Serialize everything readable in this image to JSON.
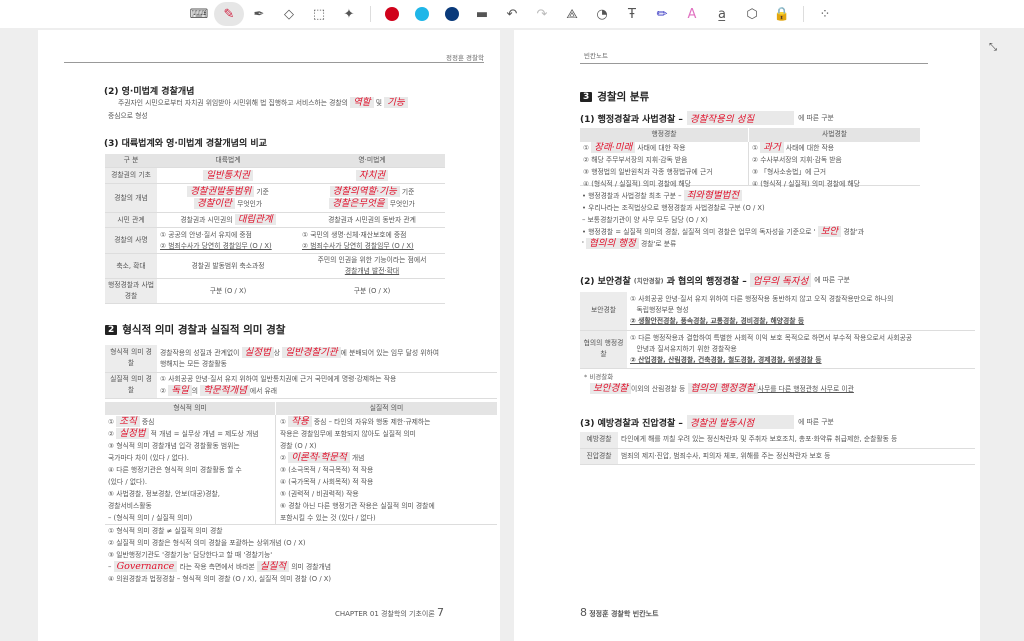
{
  "toolbar": {
    "colors": [
      "#d0021b",
      "#1fb6e8",
      "#0a3a7a"
    ],
    "icons": [
      "keyboard-icon",
      "pen-icon",
      "highlighter-icon",
      "eraser-icon",
      "lasso-select-icon",
      "ai-sparkle-icon",
      "line-thickness-icon",
      "undo-icon",
      "redo-icon",
      "shape-recognize-icon",
      "timer-pen-icon",
      "text-pen-icon",
      "blue-marker-icon",
      "text-style-icon",
      "text-convert-icon",
      "shapes-icon",
      "lock-icon",
      "more-grid-icon"
    ]
  },
  "left": {
    "header": "정정훈 경찰학",
    "s2_title": "(2) 영·미법계 경찰개념",
    "s2_text1": "주권자인 시민으로부터 자치권 위임받아 시민위해 법 집행하고 서비스하는 경찰의",
    "s2_hw1": "역할",
    "s2_and": "및",
    "s2_hw2": "기능",
    "s2_text2": "중심으로 형성",
    "s3_title": "(3) 대륙법계와 영·미법계 경찰개념의 비교",
    "t1_head": [
      "구 분",
      "대륙법계",
      "영·미법계"
    ],
    "t1": {
      "r1": {
        "k": "경찰권의 기초",
        "a": "일반통치권",
        "b": "자치권"
      },
      "r2": {
        "k": "경찰의 개념",
        "a1": "경찰권발동범위",
        "a1s": "기준",
        "a2": "경찰이란",
        "a2s": "무엇인가",
        "b1": "경찰의역할·기능",
        "b1s": "기준",
        "b2": "경찰은무엇을",
        "b2s": "무엇인가"
      },
      "r3": {
        "k": "시민 관계",
        "a_pre": "경찰권과 시민권의",
        "a": "대립관계",
        "b": "경찰권과 시민권의 동반자 관계"
      },
      "r4": {
        "k": "경찰의 사명",
        "a1": "① 공공의 안녕·질서 유지에 중점",
        "a2": "② 범죄수사가 당연히 경찰임무 (O / X)",
        "b1": "① 국민의 생명·신체·재산보호에 중점",
        "b2": "② 범죄수사가 당연히 경찰임무 (O / X)"
      },
      "r5": {
        "k": "축소, 확대",
        "a": "경찰권 발동범위 축소과정",
        "b1": "주민의 인권을 위한 기능이라는 점에서",
        "b2": "경찰개념 발전·확대"
      },
      "r6": {
        "k": "행정경찰과 사법경찰",
        "a": "구분 (O / X)",
        "b": "구분 (O / X)"
      }
    },
    "sec2_num": "2",
    "sec2_title": "형식적 의미 경찰과 실질적 의미 경찰",
    "t2": {
      "r1k": "형식적 의미 경찰",
      "r1_pre": "경찰작용의 성질과 관계없이",
      "r1_hw1": "실정법",
      "r1_mid": "상",
      "r1_hw2": "일반경찰기관",
      "r1_post": "에 분배되어 있는 임무 달성 위하여",
      "r1_2": "행해지는 모든 경찰활동",
      "r2k": "실질적 의미 경찰",
      "r2_1": "① 사회공공 안녕·질서 유지 위하여 일반통치권에 근거 국민에게 명령·강제하는 작용",
      "r2_pre": "②",
      "r2_hw1": "독일",
      "r2_mid": "의",
      "r2_hw2": "학문적개념",
      "r2_post": "에서 유래"
    },
    "t3_head": [
      "형식적 의미",
      "실질적 의미"
    ],
    "t3_left": [
      {
        "pre": "①",
        "hw": "조직",
        "post": "중심"
      },
      {
        "pre": "②",
        "hw": "실정법",
        "post": "적 개념 = 실무상 개념 = 제도상 개념"
      },
      {
        "pre": "③ 형식적 의미 경찰개념 입각 경찰활동 범위는",
        "hw": "",
        "post": ""
      },
      {
        "pre": "국가마다 차이 (있다 / 없다).",
        "hw": "",
        "post": ""
      },
      {
        "pre": "④ 다른 행정기관은 형식적 의미 경찰활동 할 수",
        "hw": "",
        "post": ""
      },
      {
        "pre": "(있다 / 없다).",
        "hw": "",
        "post": ""
      },
      {
        "pre": "⑤ 사법경찰, 정보경찰, 안보(대공)경찰,",
        "hw": "",
        "post": ""
      },
      {
        "pre": "경찰서비스활동",
        "hw": "",
        "post": ""
      },
      {
        "pre": "– (형식적 의미 / 실질적 의미)",
        "hw": "",
        "post": ""
      }
    ],
    "t3_right": [
      {
        "pre": "①",
        "hw": "작용",
        "post": "중심 – 타인의 자유와 행동 제한·규제하는"
      },
      {
        "pre": "작용은 경찰임무에 포함되지 않아도 실질적 의미",
        "hw": "",
        "post": ""
      },
      {
        "pre": "경찰 (O / X)",
        "hw": "",
        "post": ""
      },
      {
        "pre": "②",
        "hw": "이론적·학문적",
        "post": "개념"
      },
      {
        "pre": "③ (소극목적 / 적극목적) 적 작용",
        "hw": "",
        "post": ""
      },
      {
        "pre": "④ (국가목적 / 사회목적) 적 작용",
        "hw": "",
        "post": ""
      },
      {
        "pre": "⑤ (권력적 / 비권력적) 작용",
        "hw": "",
        "post": ""
      },
      {
        "pre": "⑥ 경찰 아닌 다른 행정기관 작용은 실질적 의미 경찰에",
        "hw": "",
        "post": ""
      },
      {
        "pre": "포함시킬 수 있는 것 (있다 / 없다)",
        "hw": "",
        "post": ""
      }
    ],
    "notes": [
      {
        "pre": "① 형식적 의미 경찰 ≠ 실질적 의미 경찰",
        "hw": "",
        "post": ""
      },
      {
        "pre": "② 실질적 의미 경찰은 형식적 의미 경찰을 포괄하는 상위개념 (O / X)",
        "hw": "",
        "post": ""
      },
      {
        "pre": "③ 일반행정기관도 '경찰기능' 담당한다고 할 때 '경찰기능'",
        "hw": "",
        "post": ""
      },
      {
        "pre": "–",
        "hw": "Governance",
        "post": "라는 작용 측면에서 바라본",
        "hw2": "실질적",
        "post2": "의미 경찰개념"
      },
      {
        "pre": "④ 의원경찰과 법정경찰 – 형식적 의미 경찰 (O / X), 실질적 의미 경찰 (O / X)",
        "hw": "",
        "post": ""
      }
    ],
    "footer_chapter": "CHAPTER 01  경찰학의 기초이론",
    "footer_page": "7"
  },
  "right": {
    "header": "빈칸노트",
    "sec3_num": "3",
    "sec3_title": "경찰의 분류",
    "p1_title": "(1) 행정경찰과 사법경찰 –",
    "p1_hw": "경찰작용의 성질",
    "p1_post": "에 따른 구분",
    "t4_head": [
      "행정경찰",
      "사법경찰"
    ],
    "t4_left": [
      {
        "pre": "①",
        "hw": "장래·미래",
        "post": "사태에 대한 작용"
      },
      {
        "pre": "② 해당 주무부서장의 지휘·감독 받음",
        "hw": "",
        "post": ""
      },
      {
        "pre": "③ 행정법의 일반원칙과 각종 행정법규에 근거",
        "hw": "",
        "post": ""
      },
      {
        "pre": "④ (형식적 / 실질적) 의미 경찰에 해당",
        "hw": "",
        "post": ""
      }
    ],
    "t4_right": [
      {
        "pre": "①",
        "hw": "과거",
        "post": "사태에 대한 작용"
      },
      {
        "pre": "② 수사부서장의 지휘·감독 받음",
        "hw": "",
        "post": ""
      },
      {
        "pre": "③ 「형사소송법」에 근거",
        "hw": "",
        "post": ""
      },
      {
        "pre": "④ (형식적 / 실질적) 의미 경찰에 해당",
        "hw": "",
        "post": ""
      }
    ],
    "bullets": [
      {
        "pre": "• 행정경찰과 사법경찰 최초 구분 –",
        "hw": "죄와형벌법전",
        "post": ""
      },
      {
        "pre": "• 우리나라는 조직법상으로 행정경찰과 사법경찰로 구분 (O / X)",
        "hw": "",
        "post": ""
      },
      {
        "pre": "  – 보통경찰기관이 양 사무 모두 담당 (O / X)",
        "hw": "",
        "post": ""
      },
      {
        "pre": "• 행정경찰 = 실질적 의미의 경찰, 실질적 의미 경찰은 업무의 독자성을 기준으로 '",
        "hw": "보안",
        "post": "경찰'과"
      },
      {
        "pre": "'",
        "hw": "협의의 행정",
        "post": "경찰'로 분류"
      }
    ],
    "p2_title": "(2) 보안경찰",
    "p2_small": "(치안경찰)",
    "p2_title2": "과 협의의 행정경찰 –",
    "p2_hw": "업무의 독자성",
    "p2_post": "에 따른 구분",
    "t5": [
      {
        "k": "보안경찰",
        "l1": "① 사회공공 안녕·질서 유지 위하여 다른 행정작용 동반하지 않고 오직 경찰작용만으로 하나의",
        "l2": "독립행정부문 형성",
        "l3": "② 생활안전경찰, 풍속경찰, 교통경찰, 경비경찰, 해양경찰 등"
      },
      {
        "k": "협의의 행정경찰",
        "l1": "① 다른 행정작용과 결합하여 특별한 사회적 이익 보호 목적으로 하면서 부수적 작용으로서 사회공공",
        "l2": "안녕과 질서유지하기 위한 경찰작용",
        "l3": "② 산업경찰, 산림경찰, 건축경찰, 철도경찰, 경제경찰, 위생경찰 등"
      }
    ],
    "nonpolice_label": "* 비경찰화",
    "nonpolice": {
      "hw1": "보안경찰",
      "mid": "이외의 산림경찰 등",
      "hw2": "협의의 행정경찰",
      "post": "사무를 다른 행정관청 사무로 이관"
    },
    "p3_title": "(3) 예방경찰과 진압경찰 –",
    "p3_hw": "경찰권 발동시점",
    "p3_post": "에 따른 구분",
    "t6": [
      {
        "k": "예방경찰",
        "v": "타인에게 해를 끼칠 우려 있는 정신착란자 및 주취자 보호조치, 총포·화약류 취급제한, 순찰활동 등"
      },
      {
        "k": "진압경찰",
        "v": "범죄의 제지·진압, 범죄수사, 피의자 체포, 위해를 주는 정신착란자 보호 등"
      }
    ],
    "footer_page": "8",
    "footer_title": "정정훈 경찰학 빈칸노트"
  }
}
